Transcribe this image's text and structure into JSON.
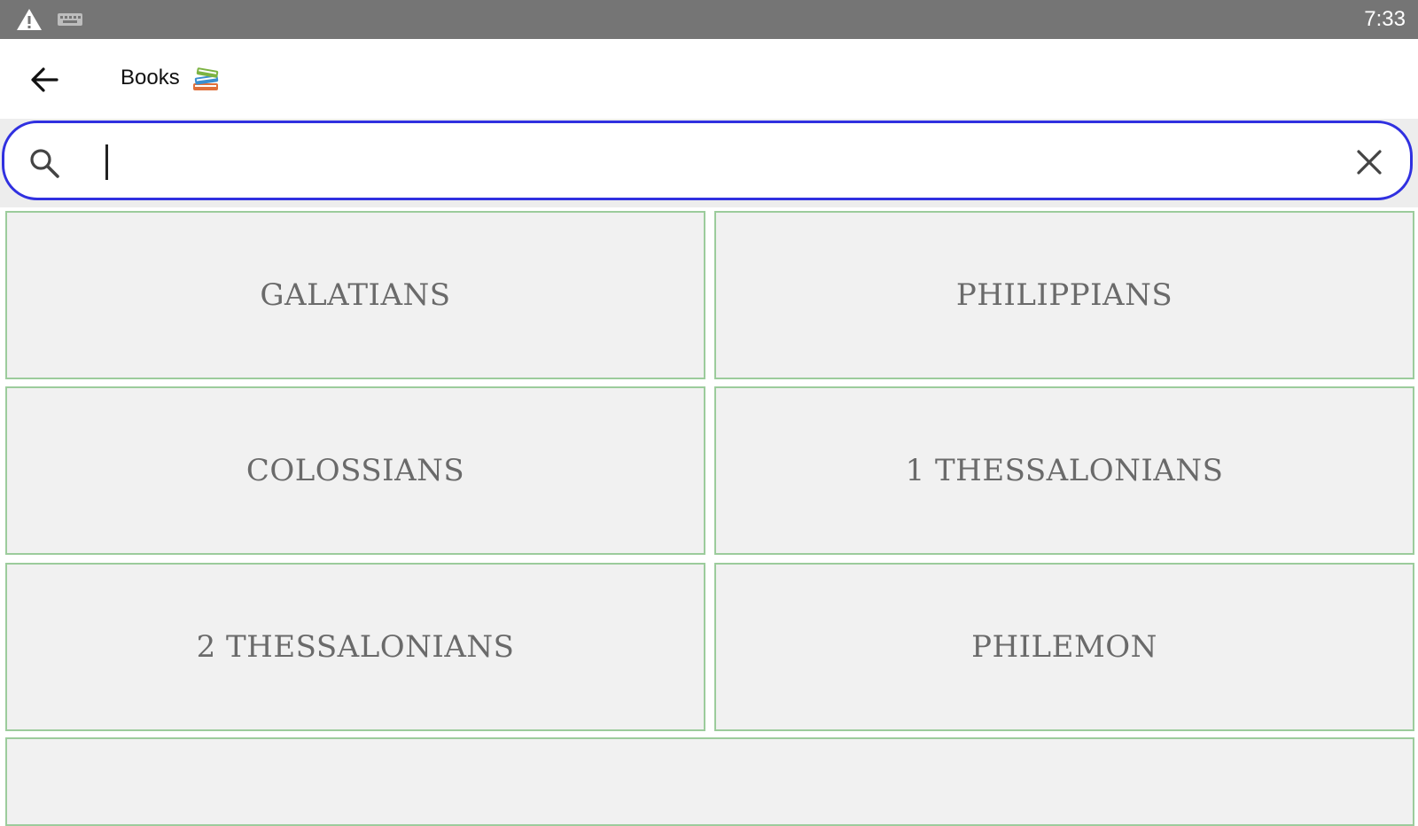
{
  "status_bar": {
    "time": "7:33",
    "icons": [
      "warning-icon",
      "keyboard-icon"
    ],
    "background": "#757575"
  },
  "app_bar": {
    "title": "Books",
    "back_icon": "arrow-left-icon",
    "title_icon": "books-emoji-icon"
  },
  "search": {
    "value": "",
    "placeholder": "",
    "search_icon": "search-icon",
    "clear_icon": "close-icon",
    "focus_color": "#3030e0"
  },
  "books": [
    {
      "label": "GALATIANS"
    },
    {
      "label": "PHILIPPIANS"
    },
    {
      "label": "COLOSSIANS"
    },
    {
      "label": "1 THESSALONIANS"
    },
    {
      "label": "2 THESSALONIANS"
    },
    {
      "label": "PHILEMON"
    },
    {
      "label": ""
    }
  ],
  "colors": {
    "tile_background": "#f1f1f1",
    "tile_border": "#9ccc9c",
    "tile_text": "#6a6a6a"
  }
}
